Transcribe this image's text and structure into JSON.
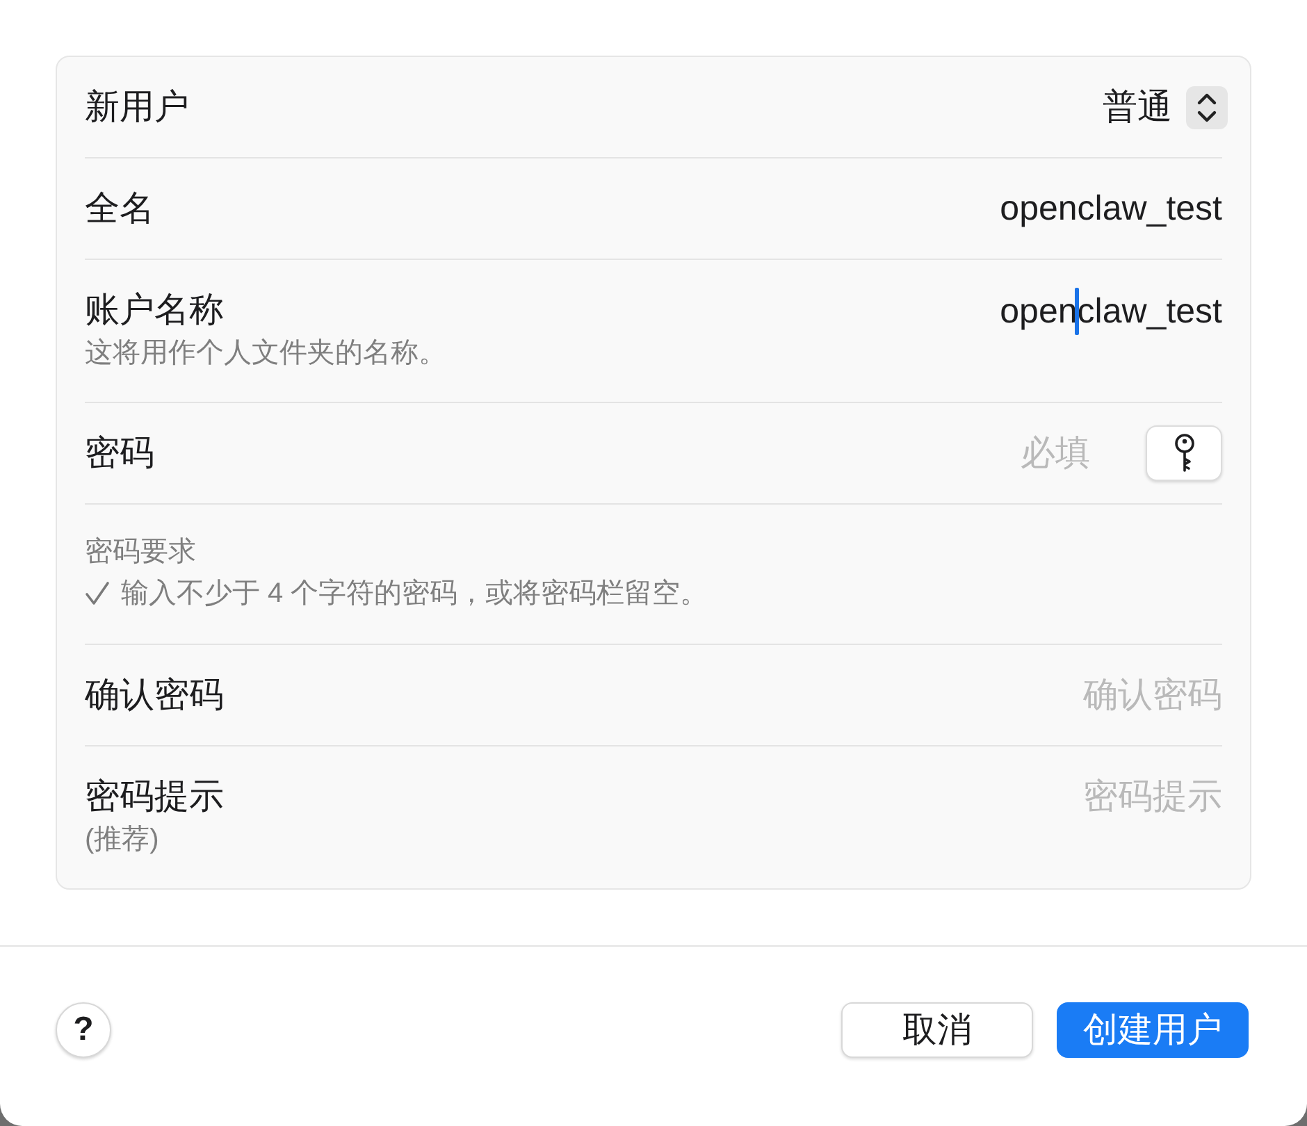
{
  "form": {
    "rows": [
      {
        "kind": "popup",
        "label": "新用户",
        "value": "普通"
      },
      {
        "kind": "field",
        "label": "全名",
        "value": "openclaw_test",
        "focused": false
      },
      {
        "kind": "field",
        "label": "账户名称",
        "note": "这将用作个人文件夹的名称。",
        "value_before_caret": "open",
        "value_after_caret": "claw_test",
        "focused": true
      },
      {
        "kind": "secure_field",
        "label": "密码",
        "placeholder": "必填",
        "focused": false
      },
      {
        "kind": "requirements",
        "title": "密码要求",
        "items": [
          {
            "text": "输入不少于 4 个字符的密码，或将密码栏留空。",
            "satisfied": true
          }
        ]
      },
      {
        "kind": "field",
        "label": "确认密码",
        "placeholder": "确认密码",
        "focused": false
      },
      {
        "kind": "field",
        "label": "密码提示",
        "note": "(推荐)",
        "placeholder": "密码提示",
        "focused": false
      }
    ]
  },
  "footer": {
    "help_button": "?",
    "buttons": [
      {
        "label": "取消",
        "kind": "secondary"
      },
      {
        "label": "创建用户",
        "kind": "primary"
      }
    ]
  }
}
